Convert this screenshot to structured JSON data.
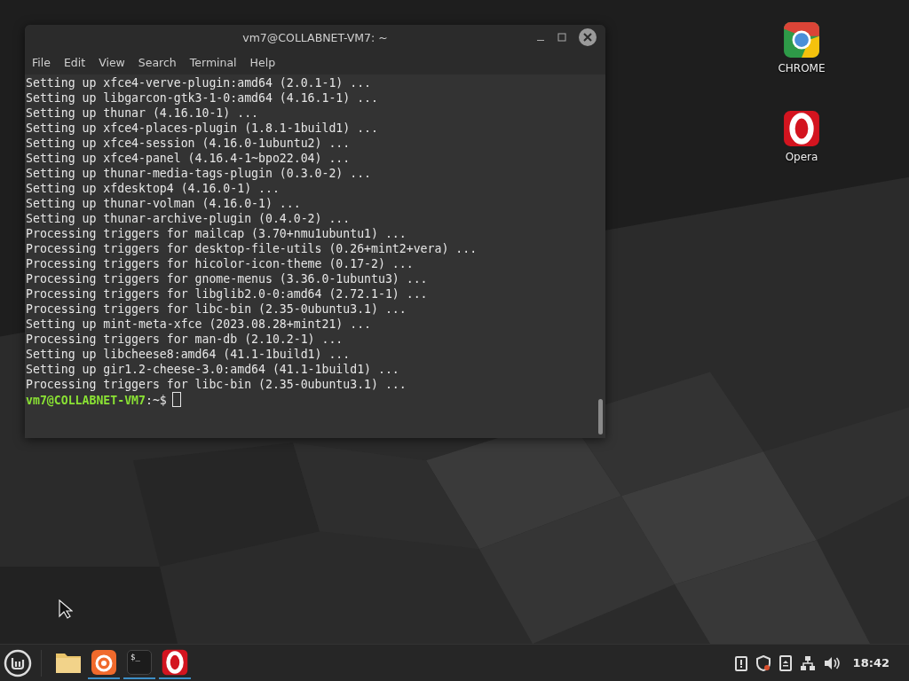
{
  "terminal": {
    "title": "vm7@COLLABNET-VM7: ~",
    "menu": [
      "File",
      "Edit",
      "View",
      "Search",
      "Terminal",
      "Help"
    ],
    "lines": [
      "Setting up xfce4-verve-plugin:amd64 (2.0.1-1) ...",
      "Setting up libgarcon-gtk3-1-0:amd64 (4.16.1-1) ...",
      "Setting up thunar (4.16.10-1) ...",
      "Setting up xfce4-places-plugin (1.8.1-1build1) ...",
      "Setting up xfce4-session (4.16.0-1ubuntu2) ...",
      "Setting up xfce4-panel (4.16.4-1~bpo22.04) ...",
      "Setting up thunar-media-tags-plugin (0.3.0-2) ...",
      "Setting up xfdesktop4 (4.16.0-1) ...",
      "Setting up thunar-volman (4.16.0-1) ...",
      "Setting up thunar-archive-plugin (0.4.0-2) ...",
      "Processing triggers for mailcap (3.70+nmu1ubuntu1) ...",
      "Processing triggers for desktop-file-utils (0.26+mint2+vera) ...",
      "Processing triggers for hicolor-icon-theme (0.17-2) ...",
      "Processing triggers for gnome-menus (3.36.0-1ubuntu3) ...",
      "Processing triggers for libglib2.0-0:amd64 (2.72.1-1) ...",
      "Processing triggers for libc-bin (2.35-0ubuntu3.1) ...",
      "Setting up mint-meta-xfce (2023.08.28+mint21) ...",
      "Processing triggers for man-db (2.10.2-1) ...",
      "Setting up libcheese8:amd64 (41.1-1build1) ...",
      "Setting up gir1.2-cheese-3.0:amd64 (41.1-1build1) ...",
      "Processing triggers for libc-bin (2.35-0ubuntu3.1) ..."
    ],
    "prompt": {
      "user": "vm7@COLLABNET-VM7",
      "path": ":~$"
    }
  },
  "desktop_icons": [
    {
      "kind": "chrome",
      "label": "CHROME"
    },
    {
      "kind": "opera",
      "label": "Opera"
    }
  ],
  "taskbar": {
    "apps": [
      {
        "kind": "files",
        "running": false
      },
      {
        "kind": "firefox",
        "running": true
      },
      {
        "kind": "terminal",
        "text": "$_",
        "running": true
      },
      {
        "kind": "opera",
        "running": true
      }
    ],
    "clock": "18:42"
  }
}
